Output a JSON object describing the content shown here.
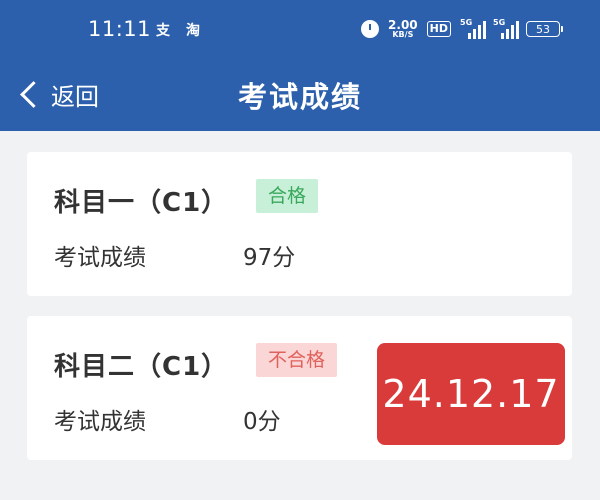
{
  "status_bar": {
    "time": "11:11",
    "app_icons": [
      "支",
      "淘"
    ],
    "net_speed_value": "2.00",
    "net_speed_unit": "KB/S",
    "hd_label": "HD",
    "signal_tags": [
      "5G",
      "5G"
    ],
    "battery_level": "53"
  },
  "nav": {
    "back_label": "返回",
    "title": "考试成绩"
  },
  "results": [
    {
      "subject": "科目一（C1）",
      "status": "合格",
      "score_label": "考试成绩",
      "score_value": "97分"
    },
    {
      "subject": "科目二（C1）",
      "status": "不合格",
      "score_label": "考试成绩",
      "score_value": "0分",
      "date_stamp": "24.12.17"
    }
  ],
  "colors": {
    "header_bg": "#2c60ac",
    "pass_text": "#3aa85c",
    "pass_bg": "#c8f0d8",
    "fail_text": "#e0625c",
    "fail_bg": "#fbd6d6",
    "stamp_bg": "#d93a3a"
  }
}
